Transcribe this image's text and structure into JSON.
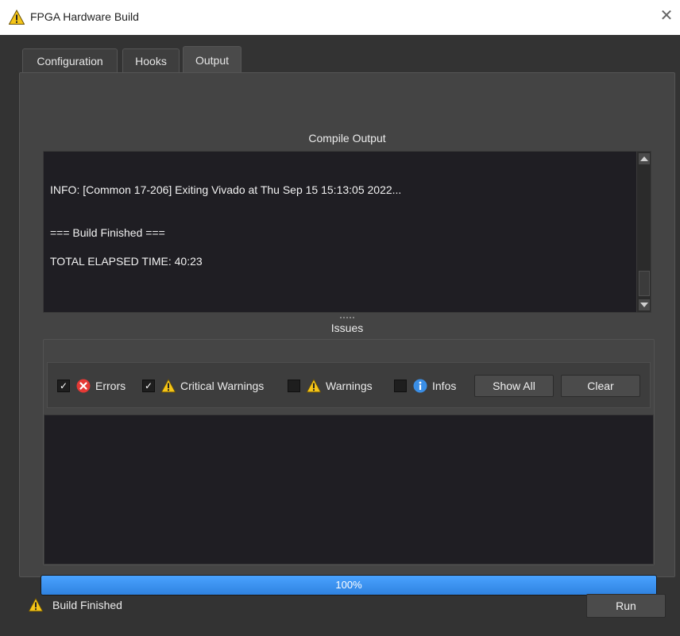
{
  "window": {
    "title": "FPGA Hardware Build",
    "icon": "warning-triangle-icon",
    "close_glyph": "✕"
  },
  "tabs": [
    {
      "label": "Configuration",
      "active": false
    },
    {
      "label": "Hooks",
      "active": false
    },
    {
      "label": "Output",
      "active": true
    }
  ],
  "compile_output": {
    "heading": "Compile Output",
    "lines": [
      "INFO: [Common 17-206] Exiting Vivado at Thu Sep 15 15:13:05 2022...",
      "=== Build Finished ===",
      "TOTAL ELAPSED TIME: 40:23"
    ]
  },
  "issues": {
    "heading": "Issues",
    "filters": [
      {
        "label": "Errors",
        "checked": true,
        "icon": "error-icon",
        "check_glyph": "✓"
      },
      {
        "label": "Critical Warnings",
        "checked": true,
        "icon": "warning-icon",
        "check_glyph": "✓"
      },
      {
        "label": "Warnings",
        "checked": false,
        "icon": "warning-icon",
        "check_glyph": ""
      },
      {
        "label": "Infos",
        "checked": false,
        "icon": "info-icon",
        "check_glyph": ""
      }
    ],
    "show_all_label": "Show All",
    "clear_label": "Clear"
  },
  "progress": {
    "value": 1.0,
    "text": "100%"
  },
  "status": {
    "icon": "warning-icon",
    "text": "Build Finished"
  },
  "run_label": "Run",
  "colors": {
    "accent": "#3b8fef",
    "warning": "#f5c518",
    "error": "#e53935",
    "info": "#3a8ee6",
    "window_bg": "#333333",
    "console_bg": "#1f1e23"
  }
}
